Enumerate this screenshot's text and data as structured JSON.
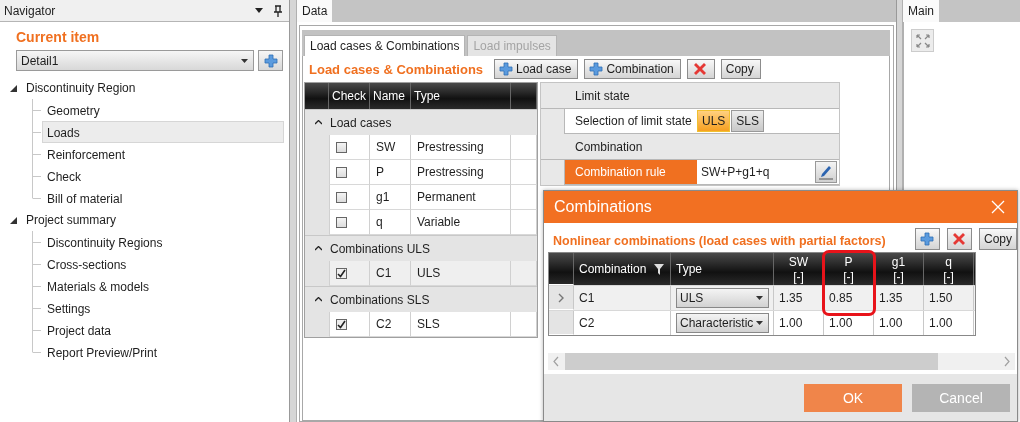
{
  "navigator": {
    "title": "Navigator",
    "section_title": "Current item",
    "current_item": "Detail1",
    "tree": [
      {
        "label": "Discontinuity Region",
        "expanded": true,
        "children": [
          {
            "label": "Geometry",
            "selected": false
          },
          {
            "label": "Loads",
            "selected": true
          },
          {
            "label": "Reinforcement",
            "selected": false
          },
          {
            "label": "Check",
            "selected": false
          },
          {
            "label": "Bill of material",
            "selected": false
          }
        ]
      },
      {
        "label": "Project summary",
        "expanded": true,
        "children": [
          {
            "label": "Discontinuity Regions",
            "selected": false
          },
          {
            "label": "Cross-sections",
            "selected": false
          },
          {
            "label": "Materials & models",
            "selected": false
          },
          {
            "label": "Settings",
            "selected": false
          },
          {
            "label": "Project data",
            "selected": false
          },
          {
            "label": "Report Preview/Print",
            "selected": false
          }
        ]
      }
    ]
  },
  "data_panel": {
    "tab": {
      "label": "Data",
      "selected": true
    },
    "subtabs": [
      {
        "label": "Load cases & Combinations",
        "selected": true,
        "disabled": false
      },
      {
        "label": "Load impulses",
        "selected": false,
        "disabled": true
      }
    ],
    "title": "Load cases & Combinations",
    "toolbar": [
      {
        "kind": "add",
        "label": "Load case"
      },
      {
        "kind": "add",
        "label": "Combination"
      },
      {
        "kind": "delete"
      },
      {
        "kind": "text",
        "label": "Copy"
      }
    ],
    "grid": {
      "columns": [
        "Check",
        "Name",
        "Type"
      ],
      "groups": [
        {
          "label": "Load cases",
          "expanded": true,
          "rows": [
            {
              "checked": false,
              "name": "SW",
              "type": "Prestressing",
              "selected": false
            },
            {
              "checked": false,
              "name": "P",
              "type": "Prestressing",
              "selected": false
            },
            {
              "checked": false,
              "name": "g1",
              "type": "Permanent",
              "selected": false
            },
            {
              "checked": false,
              "name": "q",
              "type": "Variable",
              "selected": false
            }
          ]
        },
        {
          "label": "Combinations ULS",
          "expanded": true,
          "rows": [
            {
              "checked": true,
              "name": "C1",
              "type": "ULS",
              "selected": true
            }
          ]
        },
        {
          "label": "Combinations SLS",
          "expanded": true,
          "rows": [
            {
              "checked": true,
              "name": "C2",
              "type": "SLS",
              "selected": false
            }
          ]
        }
      ]
    },
    "properties": [
      {
        "kind": "category",
        "label": "Limit state"
      },
      {
        "kind": "choice",
        "label": "Selection of limit state",
        "options": [
          {
            "label": "ULS",
            "selected": true
          },
          {
            "label": "SLS",
            "selected": false
          }
        ]
      },
      {
        "kind": "category",
        "label": "Combination"
      },
      {
        "kind": "value",
        "label": "Combination rule",
        "value": "SW+P+g1+q",
        "selected": true
      }
    ]
  },
  "main_panel": {
    "tab": {
      "label": "Main",
      "selected": true
    }
  },
  "dialog": {
    "title": "Combinations",
    "subtitle": "Nonlinear combinations (load cases with partial factors)",
    "toolbar": [
      {
        "kind": "add"
      },
      {
        "kind": "delete"
      },
      {
        "kind": "text",
        "label": "Copy"
      }
    ],
    "table": {
      "columns": [
        {
          "kind": "name",
          "label": "Combination",
          "highlighted": false
        },
        {
          "kind": "type",
          "label": "Type",
          "highlighted": false
        },
        {
          "kind": "factor",
          "label": "SW",
          "unit": "[-]",
          "highlighted": false
        },
        {
          "kind": "factor",
          "label": "P",
          "unit": "[-]",
          "highlighted": true
        },
        {
          "kind": "factor",
          "label": "g1",
          "unit": "[-]",
          "highlighted": false
        },
        {
          "kind": "factor",
          "label": "q",
          "unit": "[-]",
          "highlighted": false
        }
      ],
      "rows": [
        {
          "selected": true,
          "name": "C1",
          "type": "ULS",
          "values": [
            "1.35",
            "0.85",
            "1.35",
            "1.50"
          ]
        },
        {
          "selected": false,
          "name": "C2",
          "type": "Characteristic",
          "values": [
            "1.00",
            "1.00",
            "1.00",
            "1.00"
          ]
        }
      ]
    },
    "buttons": [
      {
        "kind": "primary",
        "label": "OK"
      },
      {
        "kind": "secondary",
        "label": "Cancel"
      }
    ]
  }
}
